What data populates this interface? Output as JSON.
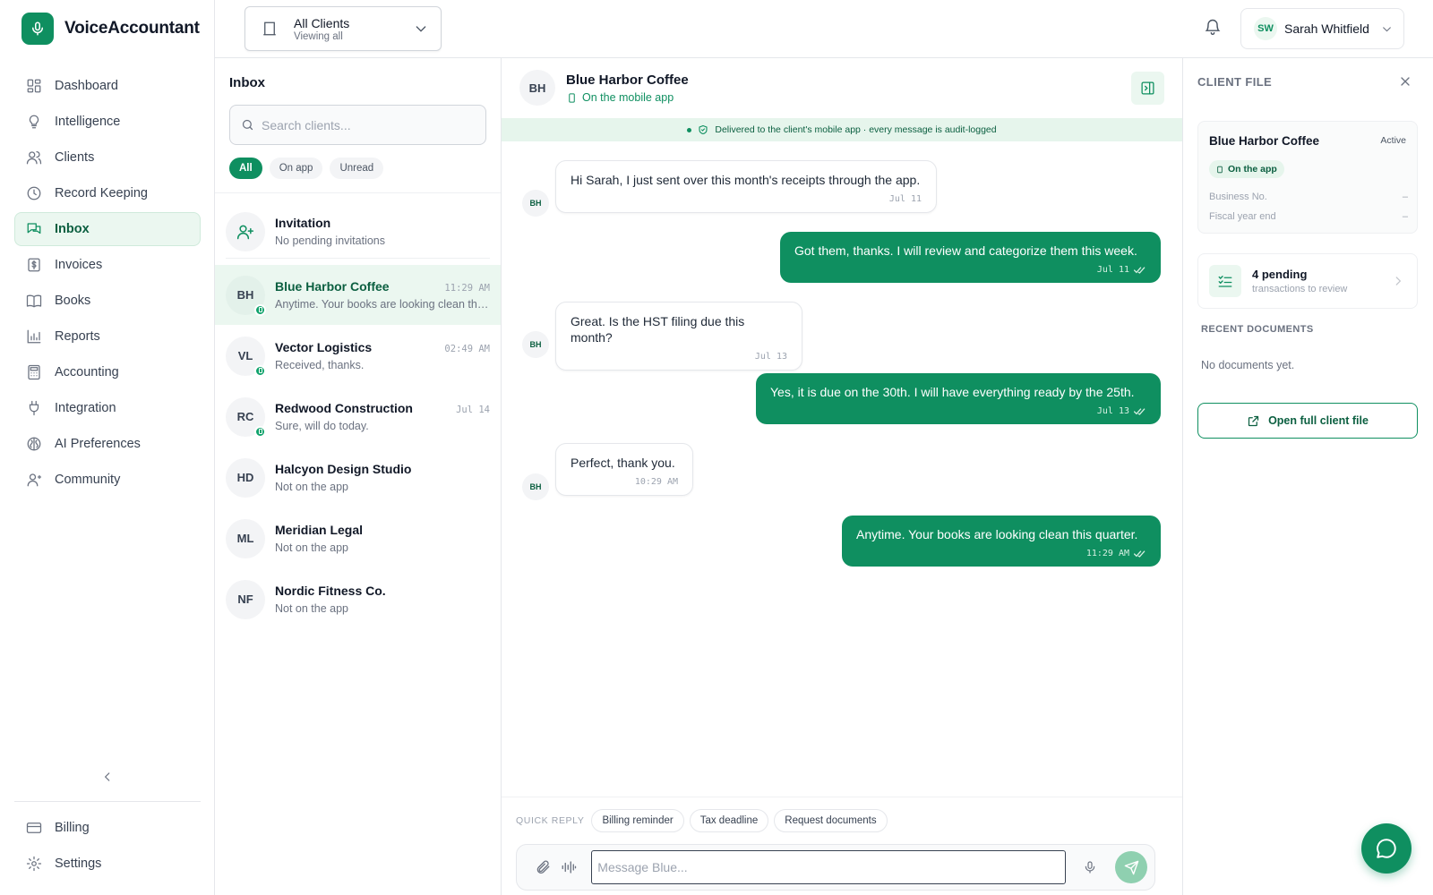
{
  "app": {
    "name": "VoiceAccountant",
    "accent": "#0f8f60"
  },
  "sidebar": {
    "items": [
      {
        "label": "Dashboard",
        "icon": "grid-icon"
      },
      {
        "label": "Intelligence",
        "icon": "lightbulb-icon"
      },
      {
        "label": "Clients",
        "icon": "users-icon"
      },
      {
        "label": "Record Keeping",
        "icon": "clock-icon"
      },
      {
        "label": "Inbox",
        "icon": "chat-icon",
        "active": true
      },
      {
        "label": "Invoices",
        "icon": "dollar-file-icon"
      },
      {
        "label": "Books",
        "icon": "book-icon"
      },
      {
        "label": "Reports",
        "icon": "bar-chart-icon"
      },
      {
        "label": "Accounting",
        "icon": "calculator-icon"
      },
      {
        "label": "Integration",
        "icon": "plug-icon"
      },
      {
        "label": "AI Preferences",
        "icon": "brain-icon"
      },
      {
        "label": "Community",
        "icon": "community-icon"
      }
    ],
    "bottom": [
      {
        "label": "Billing",
        "icon": "card-icon"
      },
      {
        "label": "Settings",
        "icon": "gear-icon"
      }
    ]
  },
  "topbar": {
    "client_select": {
      "title": "All Clients",
      "subtitle": "Viewing all"
    },
    "user": {
      "initials": "SW",
      "name": "Sarah Whitfield"
    }
  },
  "inbox": {
    "title": "Inbox",
    "search_placeholder": "Search clients...",
    "filters": [
      "All",
      "On app",
      "Unread"
    ],
    "invitation": {
      "title": "Invitation",
      "subtitle": "No pending invitations"
    },
    "conversations": [
      {
        "initials": "BH",
        "name": "Blue Harbor Coffee",
        "time": "11:29 AM",
        "preview": "Anytime. Your books are looking clean this quarter.",
        "on_app": true,
        "active": true
      },
      {
        "initials": "VL",
        "name": "Vector Logistics",
        "time": "02:49 AM",
        "preview": "Received, thanks.",
        "on_app": true
      },
      {
        "initials": "RC",
        "name": "Redwood Construction",
        "time": "Jul 14",
        "preview": "Sure, will do today.",
        "on_app": true
      },
      {
        "initials": "HD",
        "name": "Halcyon Design Studio",
        "time": "",
        "preview": "Not on the app",
        "on_app": false
      },
      {
        "initials": "ML",
        "name": "Meridian Legal",
        "time": "",
        "preview": "Not on the app",
        "on_app": false
      },
      {
        "initials": "NF",
        "name": "Nordic Fitness Co.",
        "time": "",
        "preview": "Not on the app",
        "on_app": false
      }
    ]
  },
  "chat": {
    "initials": "BH",
    "name": "Blue Harbor Coffee",
    "status": "On the mobile app",
    "audit": "Delivered to the client's mobile app · every message is audit-logged",
    "messages": [
      {
        "dir": "in",
        "text": "Hi Sarah, I just sent over this month's receipts through the app.",
        "time": "Jul 11"
      },
      {
        "dir": "out",
        "text": "Got them, thanks. I will review and categorize them this week.",
        "time": "Jul 11"
      },
      {
        "dir": "in",
        "text": "Great. Is the HST filing due this month?",
        "time": "Jul 13"
      },
      {
        "dir": "out",
        "text": "Yes, it is due on the 30th. I will have everything ready by the 25th.",
        "time": "Jul 13"
      },
      {
        "dir": "in",
        "text": "Perfect, thank you.",
        "time": "10:29 AM"
      },
      {
        "dir": "out",
        "text": "Anytime. Your books are looking clean this quarter.",
        "time": "11:29 AM"
      }
    ],
    "quick_reply_label": "QUICK REPLY",
    "quick_replies": [
      "Billing reminder",
      "Tax deadline",
      "Request documents"
    ],
    "input_placeholder": "Message Blue..."
  },
  "client_file": {
    "title": "CLIENT FILE",
    "name": "Blue Harbor Coffee",
    "badge": "Active",
    "app_status": "On the app",
    "fields": [
      {
        "label": "Business No.",
        "value": "–"
      },
      {
        "label": "Fiscal year end",
        "value": "–"
      }
    ],
    "pending": {
      "title": "4 pending",
      "subtitle": "transactions to review"
    },
    "recent_title": "RECENT DOCUMENTS",
    "recent_empty": "No documents yet.",
    "open_button": "Open full client file"
  }
}
